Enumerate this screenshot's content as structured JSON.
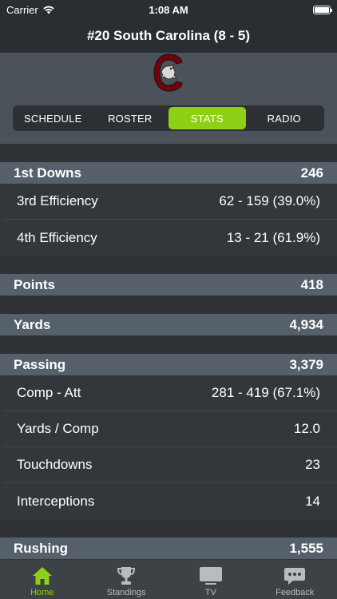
{
  "status_bar": {
    "carrier": "Carrier",
    "time": "1:08 AM"
  },
  "nav": {
    "title": "#20 South Carolina (8 - 5)"
  },
  "segments": [
    {
      "label": "SCHEDULE",
      "active": false
    },
    {
      "label": "ROSTER",
      "active": false
    },
    {
      "label": "STATS",
      "active": true
    },
    {
      "label": "RADIO",
      "active": false
    }
  ],
  "stats": {
    "first_downs": {
      "label": "1st Downs",
      "value": "246",
      "rows": [
        {
          "label": "3rd Efficiency",
          "value": "62 - 159 (39.0%)"
        },
        {
          "label": "4th Efficiency",
          "value": "13 - 21 (61.9%)"
        }
      ]
    },
    "points": {
      "label": "Points",
      "value": "418"
    },
    "yards": {
      "label": "Yards",
      "value": "4,934"
    },
    "passing": {
      "label": "Passing",
      "value": "3,379",
      "rows": [
        {
          "label": "Comp - Att",
          "value": "281 - 419 (67.1%)"
        },
        {
          "label": "Yards / Comp",
          "value": "12.0"
        },
        {
          "label": "Touchdowns",
          "value": "23"
        },
        {
          "label": "Interceptions",
          "value": "14"
        }
      ]
    },
    "rushing": {
      "label": "Rushing",
      "value": "1,555"
    }
  },
  "tabs": [
    {
      "label": "Home",
      "icon": "home-icon",
      "active": true
    },
    {
      "label": "Standings",
      "icon": "trophy-icon",
      "active": false
    },
    {
      "label": "TV",
      "icon": "tv-icon",
      "active": false
    },
    {
      "label": "Feedback",
      "icon": "feedback-icon",
      "active": false
    }
  ],
  "colors": {
    "accent": "#8fd016",
    "team_primary": "#73000a"
  }
}
